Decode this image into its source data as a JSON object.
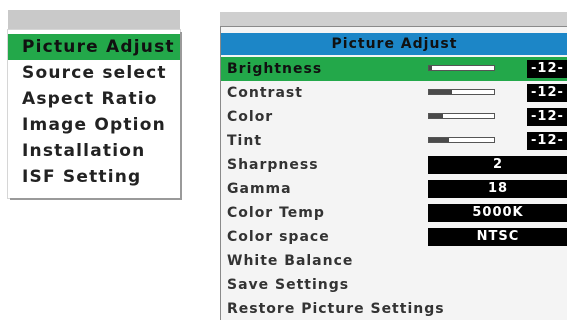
{
  "main_menu": {
    "items": [
      {
        "label": "Picture Adjust",
        "selected": true
      },
      {
        "label": "Source select",
        "selected": false
      },
      {
        "label": "Aspect Ratio",
        "selected": false
      },
      {
        "label": "Image Option",
        "selected": false
      },
      {
        "label": "Installation",
        "selected": false
      },
      {
        "label": "ISF Setting",
        "selected": false
      }
    ]
  },
  "submenu": {
    "title": "Picture Adjust",
    "rows": [
      {
        "label": "Brightness",
        "slider_fraction": 0.05,
        "value": "-12-",
        "selected": true
      },
      {
        "label": "Contrast",
        "slider_fraction": 0.35,
        "value": "-12-",
        "selected": false
      },
      {
        "label": "Color",
        "slider_fraction": 0.22,
        "value": "-12-",
        "selected": false
      },
      {
        "label": "Tint",
        "slider_fraction": 0.3,
        "value": "-12-",
        "selected": false
      },
      {
        "label": "Sharpness",
        "value": "2"
      },
      {
        "label": "Gamma",
        "value": "18"
      },
      {
        "label": "Color Temp",
        "value": "5000K"
      },
      {
        "label": "Color space",
        "value": "NTSC"
      },
      {
        "label": "White Balance"
      },
      {
        "label": "Save Settings"
      },
      {
        "label": "Restore Picture Settings"
      }
    ]
  },
  "colors": {
    "highlight": "#23a84a",
    "header": "#1c86c7",
    "value_box": "#000000"
  }
}
